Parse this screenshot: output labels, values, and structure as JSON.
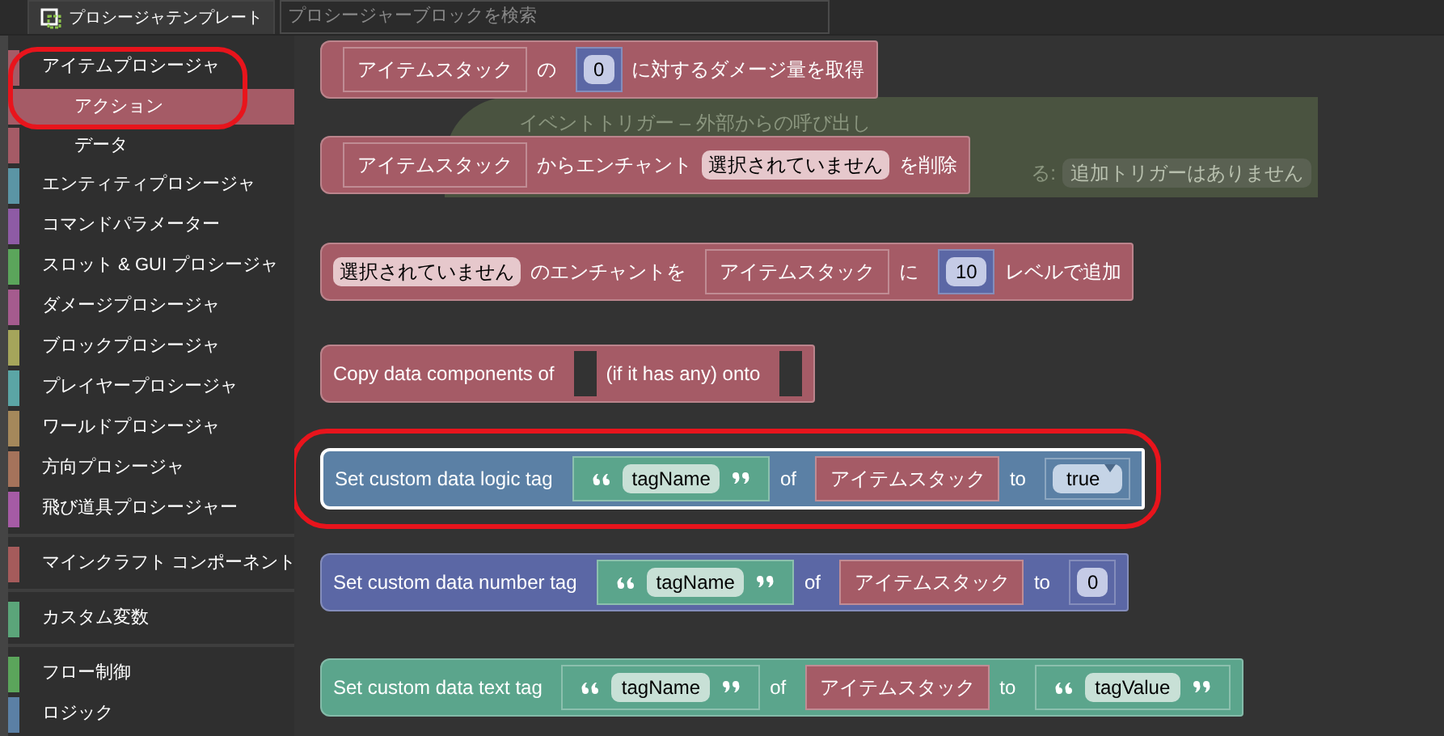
{
  "toolbar": {
    "tab": {
      "label": "プロシージャテンプレート",
      "selected": true
    },
    "search": {
      "placeholder": "プロシージャーブロックを検索"
    }
  },
  "sidebar": {
    "sections": [
      {
        "categories": [
          {
            "label": "アイテムプロシージャ",
            "color": "#a55b66",
            "highlighted": true,
            "children": [
              {
                "label": "アクション",
                "selected": true
              },
              {
                "label": "データ",
                "selected": false
              }
            ]
          },
          {
            "label": "エンティティプロシージャ",
            "color": "#5b95a5",
            "highlighted": false
          },
          {
            "label": "コマンドパラメーター",
            "color": "#8e5ba5",
            "highlighted": false
          },
          {
            "label": "スロット & GUI プロシージャ",
            "color": "#5ba55b",
            "highlighted": false
          },
          {
            "label": "ダメージプロシージャ",
            "color": "#a55b8e",
            "highlighted": false
          },
          {
            "label": "ブロックプロシージャ",
            "color": "#a5a55b",
            "highlighted": false
          },
          {
            "label": "プレイヤープロシージャ",
            "color": "#5ba5a5",
            "highlighted": false
          },
          {
            "label": "ワールドプロシージャ",
            "color": "#a5885b",
            "highlighted": false
          },
          {
            "label": "方向プロシージャ",
            "color": "#a5735b",
            "highlighted": false
          },
          {
            "label": "飛び道具プロシージャー",
            "color": "#a55ba5",
            "highlighted": false
          }
        ]
      },
      {
        "categories": [
          {
            "label": "マインクラフト コンポーネント",
            "color": "#a55b5b",
            "highlighted": false
          }
        ]
      },
      {
        "categories": [
          {
            "label": "カスタム変数",
            "color": "#5ba57a",
            "highlighted": false
          }
        ]
      },
      {
        "categories": [
          {
            "label": "フロー制御",
            "color": "#5ba55b",
            "highlighted": false
          },
          {
            "label": "ロジック",
            "color": "#5b80a5",
            "highlighted": false
          }
        ]
      }
    ]
  },
  "workspace": {
    "ghost_block": {
      "title": "イベントトリガー – 外部からの呼び出し",
      "label": "る:",
      "trigger": "追加トリガーはありません"
    },
    "blocks": [
      {
        "color": "#a55b66",
        "selected": false,
        "highlighted": false,
        "parts": [
          {
            "kind": "item",
            "value": "アイテムスタック"
          },
          {
            "kind": "text",
            "value": "の"
          },
          {
            "kind": "number",
            "value": "0"
          },
          {
            "kind": "text",
            "value": "に対するダメージ量を取得"
          }
        ]
      },
      {
        "color": "#a55b66",
        "selected": false,
        "highlighted": false,
        "parts": [
          {
            "kind": "item",
            "value": "アイテムスタック"
          },
          {
            "kind": "text",
            "value": "からエンチャント"
          },
          {
            "kind": "pill",
            "value": "選択されていません"
          },
          {
            "kind": "text",
            "value": "を削除"
          }
        ]
      },
      {
        "color": "#a55b66",
        "selected": false,
        "highlighted": false,
        "parts": [
          {
            "kind": "pill",
            "value": "選択されていません"
          },
          {
            "kind": "text",
            "value": "のエンチャントを"
          },
          {
            "kind": "item",
            "value": "アイテムスタック"
          },
          {
            "kind": "text",
            "value": "に"
          },
          {
            "kind": "number",
            "value": "10"
          },
          {
            "kind": "text",
            "value": "レベルで追加"
          }
        ]
      },
      {
        "color": "#a55b66",
        "selected": false,
        "highlighted": false,
        "parts": [
          {
            "kind": "text",
            "value": "Copy data components of"
          },
          {
            "kind": "empty"
          },
          {
            "kind": "text",
            "value": "(if it has any) onto"
          },
          {
            "kind": "empty"
          }
        ]
      },
      {
        "color": "#5b80a5",
        "selected": true,
        "highlighted": true,
        "parts": [
          {
            "kind": "text",
            "value": "Set custom data logic tag"
          },
          {
            "kind": "string",
            "value": "tagName"
          },
          {
            "kind": "text",
            "value": "of"
          },
          {
            "kind": "item",
            "value": "アイテムスタック"
          },
          {
            "kind": "text",
            "value": "to"
          },
          {
            "kind": "dropdown",
            "value": "true"
          }
        ]
      },
      {
        "color": "#5b67a5",
        "selected": false,
        "highlighted": false,
        "parts": [
          {
            "kind": "text",
            "value": "Set custom data number tag"
          },
          {
            "kind": "string",
            "value": "tagName"
          },
          {
            "kind": "text",
            "value": "of"
          },
          {
            "kind": "item",
            "value": "アイテムスタック"
          },
          {
            "kind": "text",
            "value": "to"
          },
          {
            "kind": "number",
            "value": "0"
          }
        ]
      },
      {
        "color": "#5ba58c",
        "selected": false,
        "highlighted": false,
        "parts": [
          {
            "kind": "text",
            "value": "Set custom data text tag"
          },
          {
            "kind": "string",
            "value": "tagName"
          },
          {
            "kind": "text",
            "value": "of"
          },
          {
            "kind": "item",
            "value": "アイテムスタック"
          },
          {
            "kind": "text",
            "value": "to"
          },
          {
            "kind": "string",
            "value": "tagValue"
          }
        ]
      }
    ]
  }
}
